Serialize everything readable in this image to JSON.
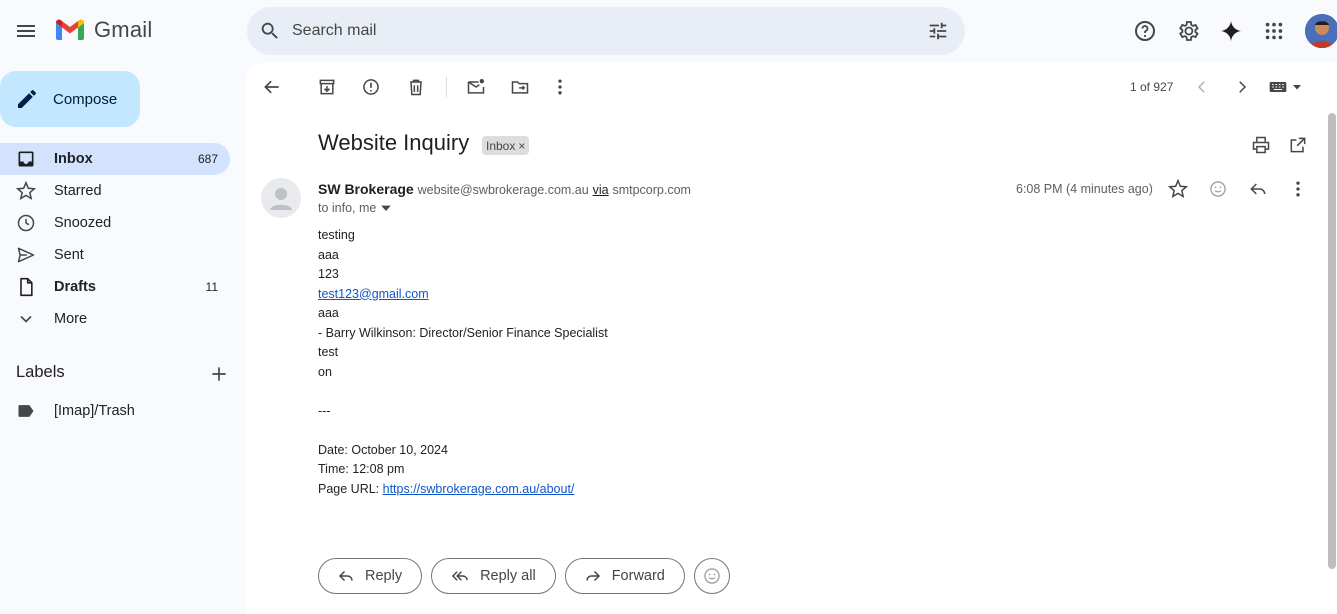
{
  "app": {
    "name": "Gmail"
  },
  "search": {
    "placeholder": "Search mail"
  },
  "sidebar": {
    "compose_label": "Compose",
    "items": [
      {
        "label": "Inbox",
        "count": "687",
        "icon": "inbox-icon"
      },
      {
        "label": "Starred",
        "count": "",
        "icon": "star-icon"
      },
      {
        "label": "Snoozed",
        "count": "",
        "icon": "clock-icon"
      },
      {
        "label": "Sent",
        "count": "",
        "icon": "send-icon"
      },
      {
        "label": "Drafts",
        "count": "11",
        "icon": "draft-icon"
      },
      {
        "label": "More",
        "count": "",
        "icon": "chevron-down-icon"
      }
    ],
    "labels_title": "Labels",
    "labels": [
      {
        "label": "[Imap]/Trash",
        "icon": "label-icon"
      }
    ]
  },
  "toolbar": {
    "pager": "1 of 927"
  },
  "message": {
    "subject": "Website Inquiry",
    "chip": "Inbox",
    "sender_name": "SW Brokerage",
    "sender_email": "website@swbrokerage.com.au",
    "via_label": "via",
    "via_domain": "smtpcorp.com",
    "to": "to info, me",
    "timestamp": "6:08 PM (4 minutes ago)",
    "body": {
      "l1": "testing",
      "l2": "aaa",
      "l3": "123",
      "l4_link": "test123@gmail.com",
      "l5": "aaa",
      "l6": "- Barry Wilkinson: Director/Senior Finance Specialist",
      "l7": "test",
      "l8": "on",
      "l9": "---",
      "l10": "Date: October 10, 2024",
      "l11": "Time: 12:08 pm",
      "l12_prefix": "Page URL: ",
      "l12_link": "https://swbrokerage.com.au/about/"
    }
  },
  "actions": {
    "reply": "Reply",
    "reply_all": "Reply all",
    "forward": "Forward"
  },
  "colors": {
    "accent": "#c2e7ff",
    "active_nav": "#d3e3fd",
    "link": "#1155cc",
    "background": "#f8fafd"
  }
}
